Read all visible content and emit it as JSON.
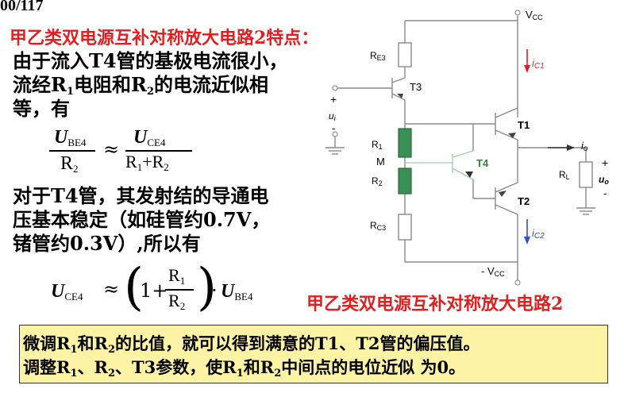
{
  "page_number": "00/117",
  "title": "甲乙类双电源互补对称放大电路2特点：",
  "intro": {
    "line1": "由于流入T4管的基极电流很小，",
    "line2_a": "流经R",
    "line2_sub1": "1",
    "line2_b": "电阻和R",
    "line2_sub2": "2",
    "line2_c": "的电流近似相",
    "line3": "等，有"
  },
  "eq1": {
    "num_left": "U",
    "num_left_sub": "BE4",
    "den_left": "R",
    "den_left_sub": "2",
    "approx": "≈",
    "num_right": "U",
    "num_right_sub": "CE4",
    "den_right_a": "R",
    "den_right_sub1": "1",
    "den_right_plus": "+R",
    "den_right_sub2": "2"
  },
  "para2": {
    "line1": "对于T4管，其发射结的导通电",
    "line2": "压基本稳定（如硅管约0.7V，",
    "line3": "锗管约0.3V）,所以有"
  },
  "eq2": {
    "lhs": "U",
    "lhs_sub": "CE4",
    "approx": "≈",
    "one_plus": "1+",
    "frac_num": "R",
    "frac_num_sub": "1",
    "frac_den": "R",
    "frac_den_sub": "2",
    "dot": "·",
    "rhs": "U",
    "rhs_sub": "BE4"
  },
  "caption": "甲乙类双电源互补对称放大电路2",
  "note": {
    "l1_a": "微调R",
    "l1_s1": "1",
    "l1_b": "和R",
    "l1_s2": "2",
    "l1_c": "的比值，就可以得到满意的T1、T2管的偏压值。",
    "l2_a": "调整R",
    "l2_s1": "1",
    "l2_b": "、R",
    "l2_s2": "2",
    "l2_c": "、T3参数，使R",
    "l2_s3": "1",
    "l2_d": "和R",
    "l2_s4": "2",
    "l2_e": "中间点的电位近似 为0。"
  },
  "circuit": {
    "vcc": "V",
    "vcc_sub": "CC",
    "neg_vcc": "- V",
    "neg_vcc_sub": "CC",
    "re3": "R",
    "re3_sub": "E3",
    "t3": "T3",
    "t1": "T1",
    "t2": "T2",
    "t4": "T4",
    "r1": "R",
    "r1_sub": "1",
    "r2": "R",
    "r2_sub": "2",
    "m": "M",
    "rc3": "R",
    "rc3_sub": "C3",
    "rl": "R",
    "rl_sub": "L",
    "ic1": "i",
    "ic1_sub": "C1",
    "ic2": "i",
    "ic2_sub": "C2",
    "io": "i",
    "io_sub": "o",
    "ui": "u",
    "ui_sub": "i",
    "uo": "u",
    "uo_sub": "o",
    "plus": "+",
    "minus": "-",
    "colors": {
      "wire": "#8a8a8a",
      "resistor_green": "#3a8f55",
      "t4_label": "#2a8a2a",
      "red_arrow": "#e02020",
      "blue_arrow": "#3050d0"
    }
  }
}
